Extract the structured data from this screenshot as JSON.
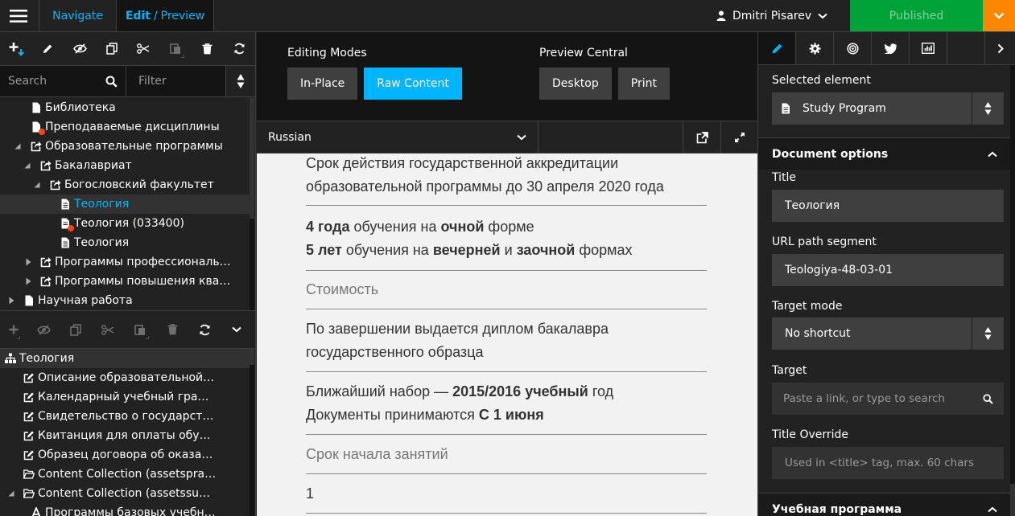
{
  "topbar": {
    "navigate_tab": "Navigate",
    "edit_label": "Edit",
    "separator": "/",
    "preview_label": "Preview",
    "user_name": "Dmitri Pisarev",
    "publish_status": "Published"
  },
  "left": {
    "search_placeholder": "Search",
    "filter_placeholder": "Filter",
    "tree": [
      {
        "label": "Библиотека"
      },
      {
        "label": "Преподаваемые дисциплины"
      },
      {
        "label": "Образовательные программы"
      },
      {
        "label": "Бакалавриат"
      },
      {
        "label": "Богословский факультет"
      },
      {
        "label": "Теология"
      },
      {
        "label": "Теология (033400)"
      },
      {
        "label": "Теология"
      },
      {
        "label": "Программы профессиональн..."
      },
      {
        "label": "Программы повышения квал..."
      },
      {
        "label": "Научная работа"
      }
    ],
    "content_tree": [
      {
        "label": "Теология"
      },
      {
        "label": "Описание образовательной п..."
      },
      {
        "label": "Календарный учебный график"
      },
      {
        "label": "Свидетельство о государстве..."
      },
      {
        "label": "Квитанция для оплаты обуче..."
      },
      {
        "label": "Образец договора об оказани..."
      },
      {
        "label": "Content Collection (assetspracti..."
      },
      {
        "label": "Content Collection (assetssubje..."
      },
      {
        "label": "Программы базовых учебных..."
      }
    ]
  },
  "center": {
    "editing_modes_title": "Editing Modes",
    "mode_inplace": "In-Place",
    "mode_raw": "Raw Content",
    "preview_central_title": "Preview Central",
    "preview_desktop": "Desktop",
    "preview_print": "Print",
    "language": "Russian",
    "content": {
      "b1_line1": "Срок действия государственной аккредитации",
      "b1_line2": "образовательной программы до 30 апреля 2020 года",
      "b2_l1_a": "4 года",
      "b2_l1_b": " обучения на ",
      "b2_l1_c": "очной",
      "b2_l1_d": " форме",
      "b2_l2_a": "5 лет",
      "b2_l2_b": " обучения на ",
      "b2_l2_c": "вечерней",
      "b2_l2_d": " и ",
      "b2_l2_e": "заочной",
      "b2_l2_f": " формах",
      "b3": "Стоимость",
      "b4_line1": "По завершении выдается диплом бакалавра",
      "b4_line2": "государственного образца",
      "b5_l1_a": "Ближайший набор — ",
      "b5_l1_b": "2015/2016 учебный",
      "b5_l1_c": " год",
      "b5_l2_a": "Документы принимаются ",
      "b5_l2_b": "С 1 июня",
      "b6": "Срок начала занятий",
      "b7": "1"
    }
  },
  "right": {
    "selected_element_label": "Selected element",
    "selected_element_value": "Study Program",
    "document_options": "Document options",
    "title_label": "Title",
    "title_value": "Теология",
    "url_label": "URL path segment",
    "url_value": "Teologiya-48-03-01",
    "target_mode_label": "Target mode",
    "target_mode_value": "No shortcut",
    "target_label": "Target",
    "target_placeholder": "Paste a link, or type to search",
    "title_override_label": "Title Override",
    "title_override_placeholder": "Used in <title> tag, max. 60 chars",
    "section2": "Учебная программа"
  },
  "colors": {
    "accent": "#00b5ff",
    "published": "#00a338",
    "publish_dropdown": "#ff8700",
    "error_badge": "#ff460d"
  }
}
